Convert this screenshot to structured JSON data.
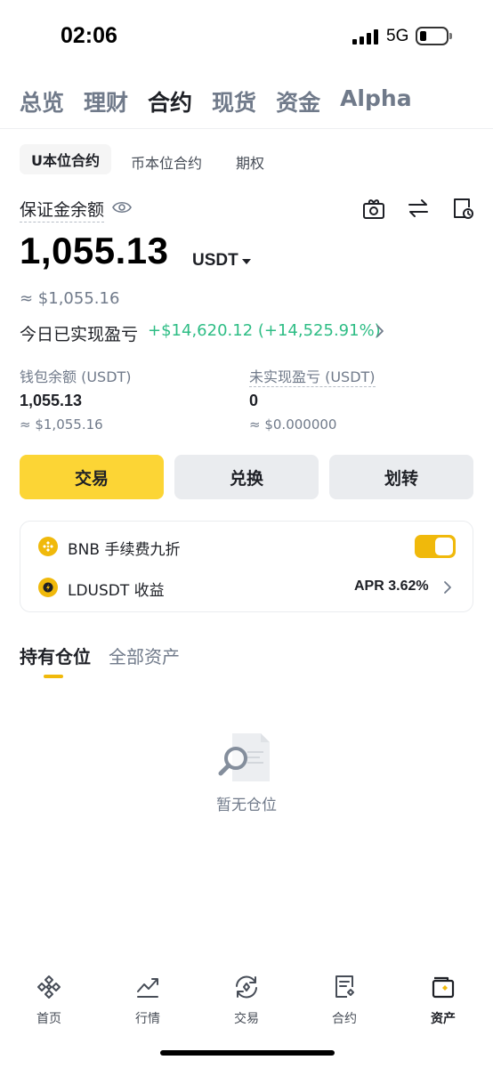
{
  "status_bar": {
    "time": "02:06",
    "network": "5G"
  },
  "top_tabs": [
    "总览",
    "理财",
    "合约",
    "现货",
    "资金",
    "Alpha"
  ],
  "active_top_tab_index": 2,
  "sub_tabs": [
    "U本位合约",
    "币本位合约",
    "期权"
  ],
  "balance": {
    "label": "保证金余额",
    "amount": "1,055.13",
    "unit": "USDT",
    "usd_value": "≈ $1,055.16",
    "pnl_label": "今日已实现盈亏",
    "pnl_value": "+$14,620.12 (+14,525.91%)"
  },
  "wallet": {
    "label": "钱包余额 (USDT)",
    "value": "1,055.13",
    "usd": "≈ $1,055.16"
  },
  "unrealized": {
    "label": "未实现盈亏 (USDT)",
    "value": "0",
    "usd": "≈ $0.000000"
  },
  "actions": {
    "trade": "交易",
    "convert": "兑换",
    "transfer": "划转"
  },
  "card": {
    "bnb_label": "BNB 手续费九折",
    "bnb_toggle_on": true,
    "ldusdt_label": "LDUSDT 收益",
    "apr": "APR 3.62%"
  },
  "positions_tabs": {
    "holding": "持有仓位",
    "all_assets": "全部资产"
  },
  "empty_text": "暂无仓位",
  "bottom_nav": [
    {
      "label": "首页",
      "icon": "home-diamond-icon"
    },
    {
      "label": "行情",
      "icon": "market-chart-icon"
    },
    {
      "label": "交易",
      "icon": "trade-cycle-icon"
    },
    {
      "label": "合约",
      "icon": "futures-doc-icon"
    },
    {
      "label": "资产",
      "icon": "wallet-icon"
    }
  ],
  "active_nav_index": 4,
  "colors": {
    "accent": "#fcd535",
    "brand_yellow": "#f0b90b",
    "profit_green": "#2ebd85",
    "muted": "#707a8a"
  }
}
